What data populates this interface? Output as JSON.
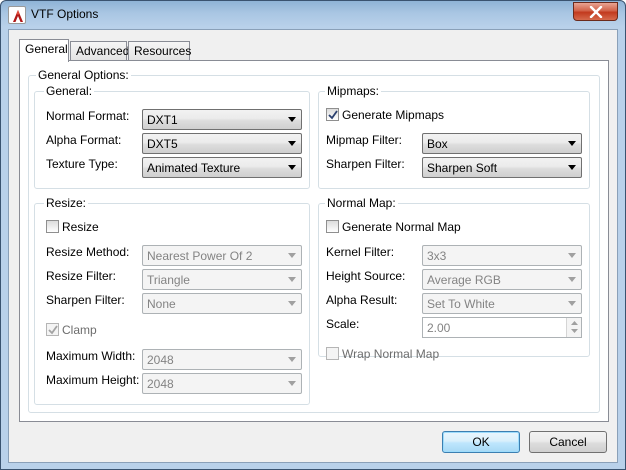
{
  "window": {
    "title": "VTF Options",
    "icons": {
      "app": "vtf-app-icon",
      "close": "close-icon"
    }
  },
  "tabs": [
    {
      "label": "General",
      "active": true
    },
    {
      "label": "Advanced",
      "active": false
    },
    {
      "label": "Resources",
      "active": false
    }
  ],
  "general_options": {
    "label": "General Options:",
    "general": {
      "label": "General:",
      "normal_format": {
        "label": "Normal Format:",
        "value": "DXT1"
      },
      "alpha_format": {
        "label": "Alpha Format:",
        "value": "DXT5"
      },
      "texture_type": {
        "label": "Texture Type:",
        "value": "Animated Texture"
      }
    },
    "mipmaps": {
      "label": "Mipmaps:",
      "generate": {
        "label": "Generate Mipmaps",
        "checked": true
      },
      "filter": {
        "label": "Mipmap Filter:",
        "value": "Box"
      },
      "sharpen": {
        "label": "Sharpen Filter:",
        "value": "Sharpen Soft"
      }
    },
    "resize": {
      "label": "Resize:",
      "resize": {
        "label": "Resize",
        "checked": false
      },
      "method": {
        "label": "Resize Method:",
        "value": "Nearest Power Of 2"
      },
      "filter": {
        "label": "Resize Filter:",
        "value": "Triangle"
      },
      "sharpen": {
        "label": "Sharpen Filter:",
        "value": "None"
      },
      "clamp": {
        "label": "Clamp",
        "checked": true
      },
      "max_width": {
        "label": "Maximum Width:",
        "value": "2048"
      },
      "max_height": {
        "label": "Maximum Height:",
        "value": "2048"
      }
    },
    "normal_map": {
      "label": "Normal Map:",
      "generate": {
        "label": "Generate Normal Map",
        "checked": false
      },
      "kernel": {
        "label": "Kernel Filter:",
        "value": "3x3"
      },
      "height_source": {
        "label": "Height Source:",
        "value": "Average RGB"
      },
      "alpha_result": {
        "label": "Alpha Result:",
        "value": "Set To White"
      },
      "scale": {
        "label": "Scale:",
        "value": "2.00"
      },
      "wrap": {
        "label": "Wrap Normal Map",
        "checked": false
      }
    }
  },
  "buttons": {
    "ok": "OK",
    "cancel": "Cancel"
  }
}
